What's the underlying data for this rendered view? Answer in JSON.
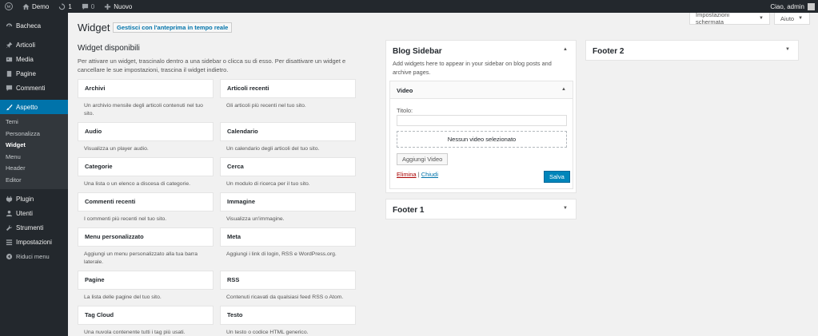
{
  "adminbar": {
    "site_name": "Demo",
    "updates_count": "1",
    "comments_count": "0",
    "new_label": "Nuovo",
    "greeting": "Ciao, admin"
  },
  "sidebar": {
    "items": [
      {
        "label": "Bacheca",
        "icon": "dashboard-icon"
      },
      {
        "label": "Articoli",
        "icon": "pin-icon"
      },
      {
        "label": "Media",
        "icon": "media-icon"
      },
      {
        "label": "Pagine",
        "icon": "page-icon"
      },
      {
        "label": "Commenti",
        "icon": "comment-icon"
      },
      {
        "label": "Aspetto",
        "icon": "brush-icon"
      },
      {
        "label": "Plugin",
        "icon": "plugin-icon"
      },
      {
        "label": "Utenti",
        "icon": "users-icon"
      },
      {
        "label": "Strumenti",
        "icon": "tools-icon"
      },
      {
        "label": "Impostazioni",
        "icon": "settings-icon"
      },
      {
        "label": "Riduci menu",
        "icon": "collapse-icon"
      }
    ],
    "submenu": [
      "Temi",
      "Personalizza",
      "Widget",
      "Menu",
      "Header",
      "Editor"
    ]
  },
  "screen_options": "Impostazioni schermata",
  "help": "Aiuto",
  "page": {
    "title": "Widget",
    "preview_button": "Gestisci con l'anteprima in tempo reale",
    "available_title": "Widget disponibili",
    "available_desc": "Per attivare un widget, trascinalo dentro a una sidebar o clicca su di esso. Per disattivare un widget e cancellare le sue impostazioni, trascina il widget indietro."
  },
  "widgets": [
    {
      "name": "Archivi",
      "desc": "Un archivio mensile degli articoli contenuti nel tuo sito."
    },
    {
      "name": "Articoli recenti",
      "desc": "Gli articoli più recenti nel tuo sito."
    },
    {
      "name": "Audio",
      "desc": "Visualizza un player audio."
    },
    {
      "name": "Calendario",
      "desc": "Un calendario degli articoli del tuo sito."
    },
    {
      "name": "Categorie",
      "desc": "Una lista o un elenco a discesa di categorie."
    },
    {
      "name": "Cerca",
      "desc": "Un modulo di ricerca per il tuo sito."
    },
    {
      "name": "Commenti recenti",
      "desc": "I commenti più recenti nel tuo sito."
    },
    {
      "name": "Immagine",
      "desc": "Visualizza un'immagine."
    },
    {
      "name": "Menu personalizzato",
      "desc": "Aggiungi un menu personalizzato alla tua barra laterale."
    },
    {
      "name": "Meta",
      "desc": "Aggiungi i link di login, RSS e WordPress.org."
    },
    {
      "name": "Pagine",
      "desc": "La lista delle pagine del tuo sito."
    },
    {
      "name": "RSS",
      "desc": "Contenuti ricavati da qualsiasi feed RSS o Atom."
    },
    {
      "name": "Tag Cloud",
      "desc": "Una nuvola contenente tutti i tag più usati."
    },
    {
      "name": "Testo",
      "desc": "Un testo o codice HTML generico."
    }
  ],
  "blog_sidebar": {
    "title": "Blog Sidebar",
    "desc": "Add widgets here to appear in your sidebar on blog posts and archive pages.",
    "widget": {
      "title": "Video",
      "field_label": "Titolo:",
      "field_value": "",
      "no_video": "Nessun video selezionato",
      "add_button": "Aggiungi Video",
      "delete_link": "Elimina",
      "separator": "|",
      "close_link": "Chiudi",
      "save_button": "Salva"
    }
  },
  "footer1": {
    "title": "Footer 1"
  },
  "footer2": {
    "title": "Footer 2"
  }
}
